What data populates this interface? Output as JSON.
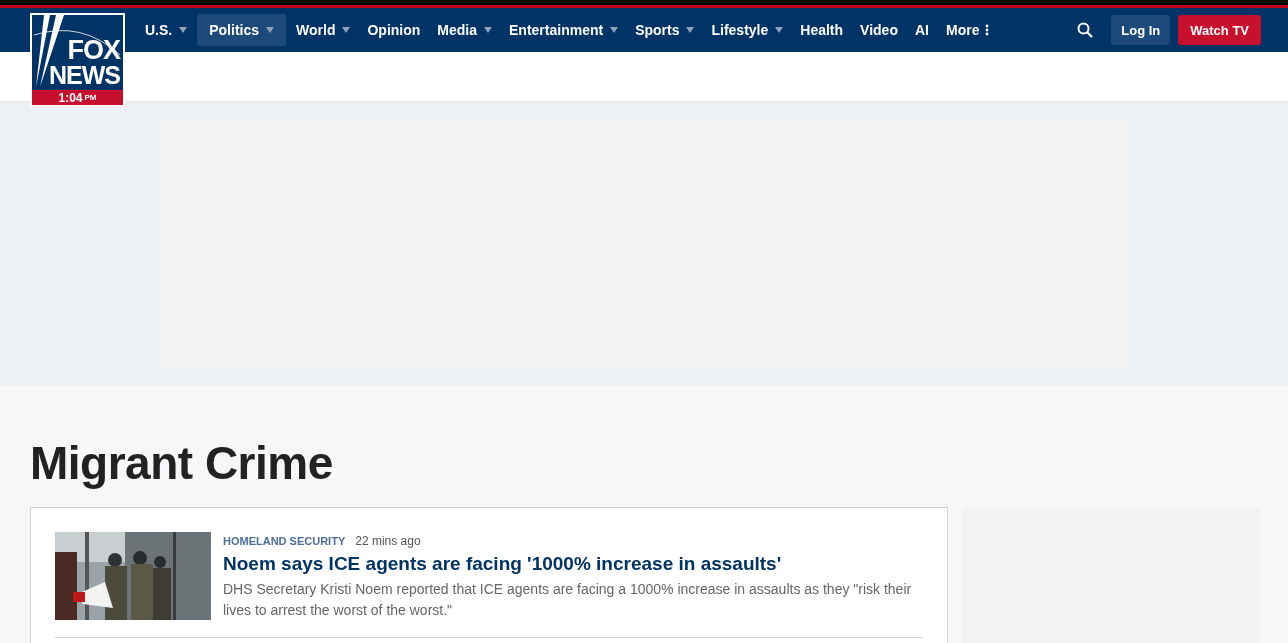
{
  "logo": {
    "line_1": "FOX",
    "line_2": "NEWS",
    "time": "1:04",
    "meridiem": "PM"
  },
  "nav": [
    {
      "label": "U.S.",
      "selected": false,
      "kind": "dropdown"
    },
    {
      "label": "Politics",
      "selected": true,
      "kind": "dropdown"
    },
    {
      "label": "World",
      "selected": false,
      "kind": "dropdown"
    },
    {
      "label": "Opinion",
      "selected": false,
      "kind": "plain"
    },
    {
      "label": "Media",
      "selected": false,
      "kind": "dropdown"
    },
    {
      "label": "Entertainment",
      "selected": false,
      "kind": "dropdown"
    },
    {
      "label": "Sports",
      "selected": false,
      "kind": "dropdown"
    },
    {
      "label": "Lifestyle",
      "selected": false,
      "kind": "dropdown"
    },
    {
      "label": "Health",
      "selected": false,
      "kind": "plain"
    },
    {
      "label": "Video",
      "selected": false,
      "kind": "plain"
    },
    {
      "label": "AI",
      "selected": false,
      "kind": "plain"
    },
    {
      "label": "More",
      "selected": false,
      "kind": "more"
    }
  ],
  "actions": {
    "login": "Log In",
    "watch": "Watch TV"
  },
  "page_title": "Migrant Crime",
  "articles": [
    {
      "kind": "picture",
      "category": "HOMELAND SECURITY",
      "time": "22 mins ago",
      "headline": "Noem says ICE agents are facing '1000% increase in assaults'",
      "summary": "DHS Secretary Kristi Noem reported that ICE agents are facing a 1000% increase in assaults as they \"risk their lives to arrest the worst of the worst.\""
    }
  ]
}
